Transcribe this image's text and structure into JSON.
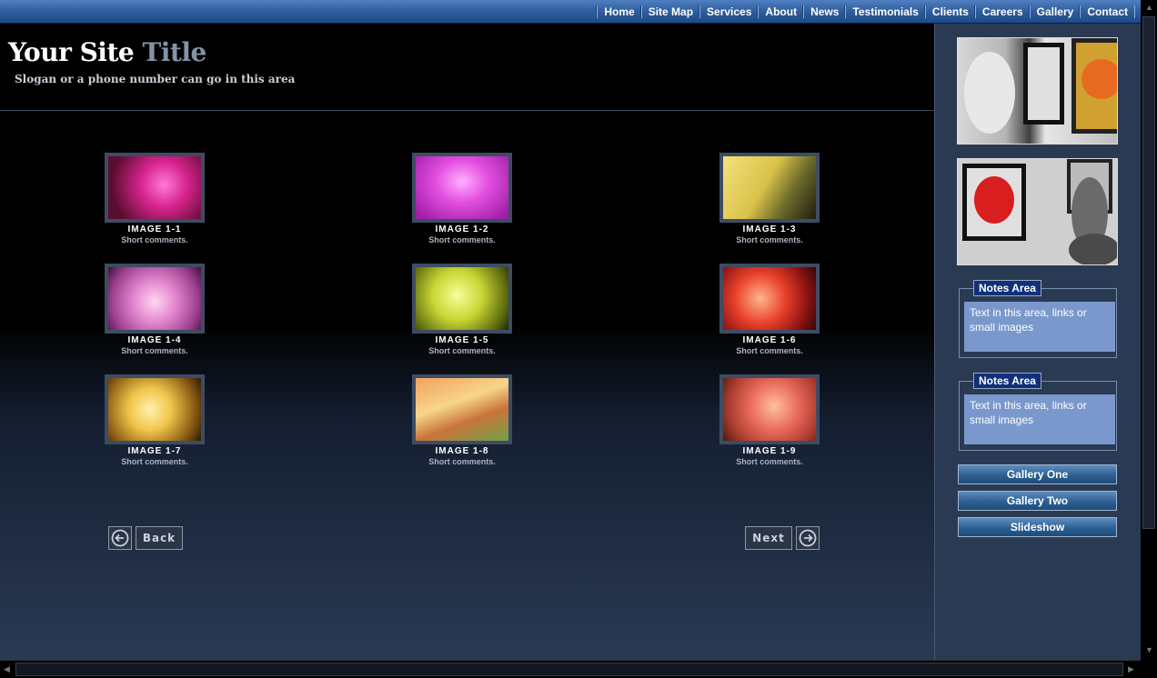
{
  "nav": {
    "items": [
      "Home",
      "Site Map",
      "Services",
      "About",
      "News",
      "Testimonials",
      "Clients",
      "Careers",
      "Gallery",
      "Contact"
    ]
  },
  "header": {
    "title_part1": "Your Site",
    "title_part2": "Title",
    "slogan": "Slogan or a phone number can go in this area"
  },
  "gallery": {
    "thumbnails": [
      {
        "title": "IMAGE 1-1",
        "comment": "Short comments."
      },
      {
        "title": "IMAGE 1-2",
        "comment": "Short comments."
      },
      {
        "title": "IMAGE 1-3",
        "comment": "Short comments."
      },
      {
        "title": "IMAGE 1-4",
        "comment": "Short comments."
      },
      {
        "title": "IMAGE 1-5",
        "comment": "Short comments."
      },
      {
        "title": "IMAGE 1-6",
        "comment": "Short comments."
      },
      {
        "title": "IMAGE 1-7",
        "comment": "Short comments."
      },
      {
        "title": "IMAGE 1-8",
        "comment": "Short comments."
      },
      {
        "title": "IMAGE 1-9",
        "comment": "Short comments."
      }
    ],
    "back_label": "Back",
    "next_label": "Next"
  },
  "sidebar": {
    "notes": [
      {
        "title": "Notes Area",
        "body": "Text in this area, links or small images"
      },
      {
        "title": "Notes Area",
        "body": "Text in this area, links or small images"
      }
    ],
    "buttons": [
      "Gallery One",
      "Gallery Two",
      "Slideshow"
    ]
  },
  "colors": {
    "nav_bar": "#2f5e9e",
    "sidebar_bg": "#2b3a53",
    "notes_body": "#7a98cc",
    "thumb_frame": "#3e4c63"
  }
}
